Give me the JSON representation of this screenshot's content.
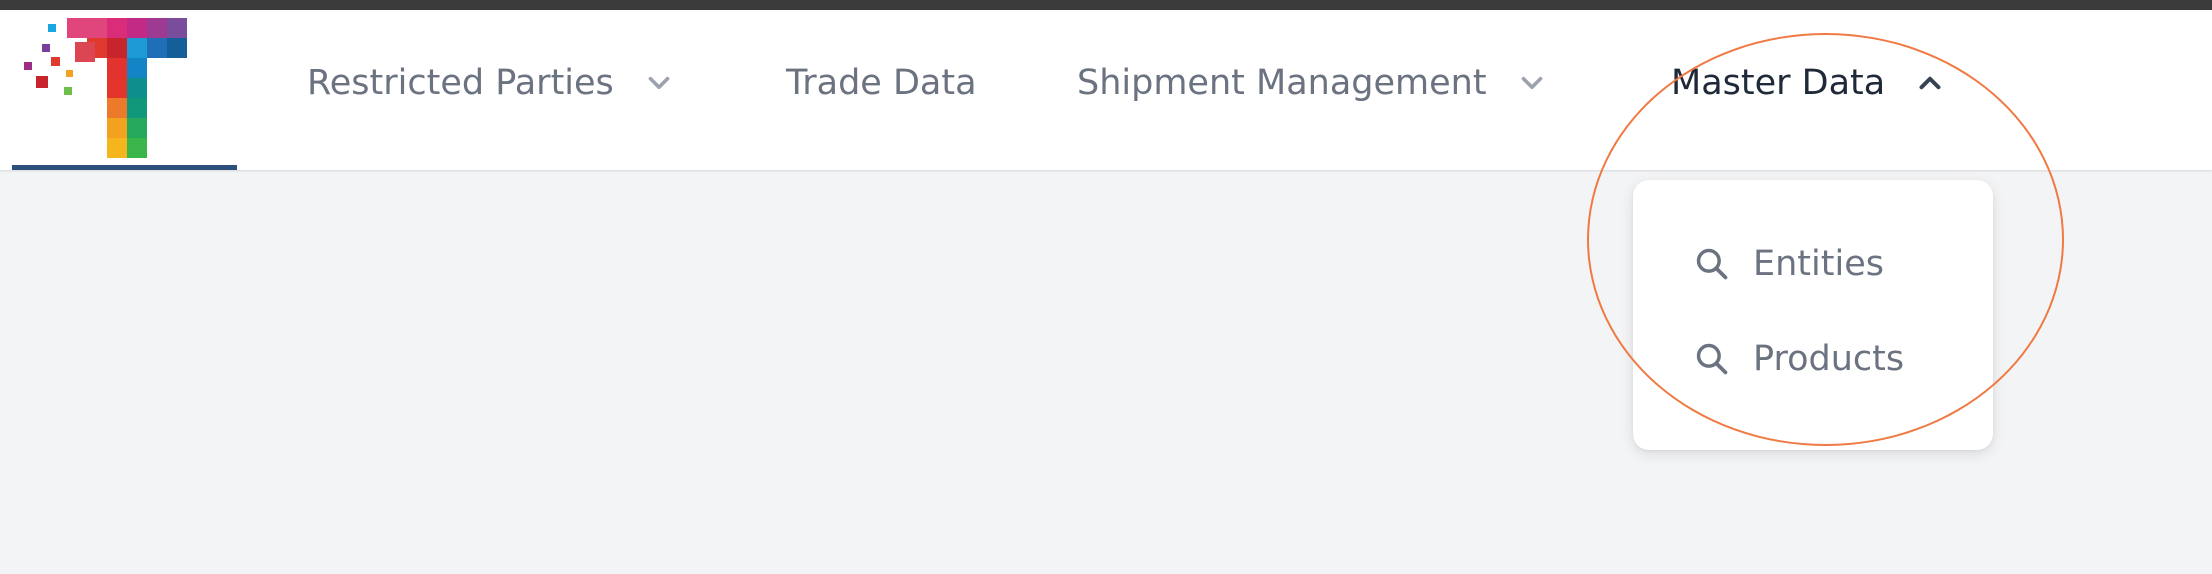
{
  "nav": {
    "items": [
      {
        "label": "Restricted Parties",
        "has_dropdown": true,
        "expanded": false
      },
      {
        "label": "Trade Data",
        "has_dropdown": false
      },
      {
        "label": "Shipment Management",
        "has_dropdown": true,
        "expanded": false
      },
      {
        "label": "Master Data",
        "has_dropdown": true,
        "expanded": true
      }
    ]
  },
  "dropdown": {
    "items": [
      {
        "label": "Entities",
        "icon": "search-icon"
      },
      {
        "label": "Products",
        "icon": "search-icon"
      }
    ]
  },
  "colors": {
    "nav_text": "#6b7280",
    "nav_text_active": "#1f2937",
    "page_background": "#f3f4f6",
    "logo_underline": "#2c4f7c",
    "highlight": "#f07a43"
  }
}
